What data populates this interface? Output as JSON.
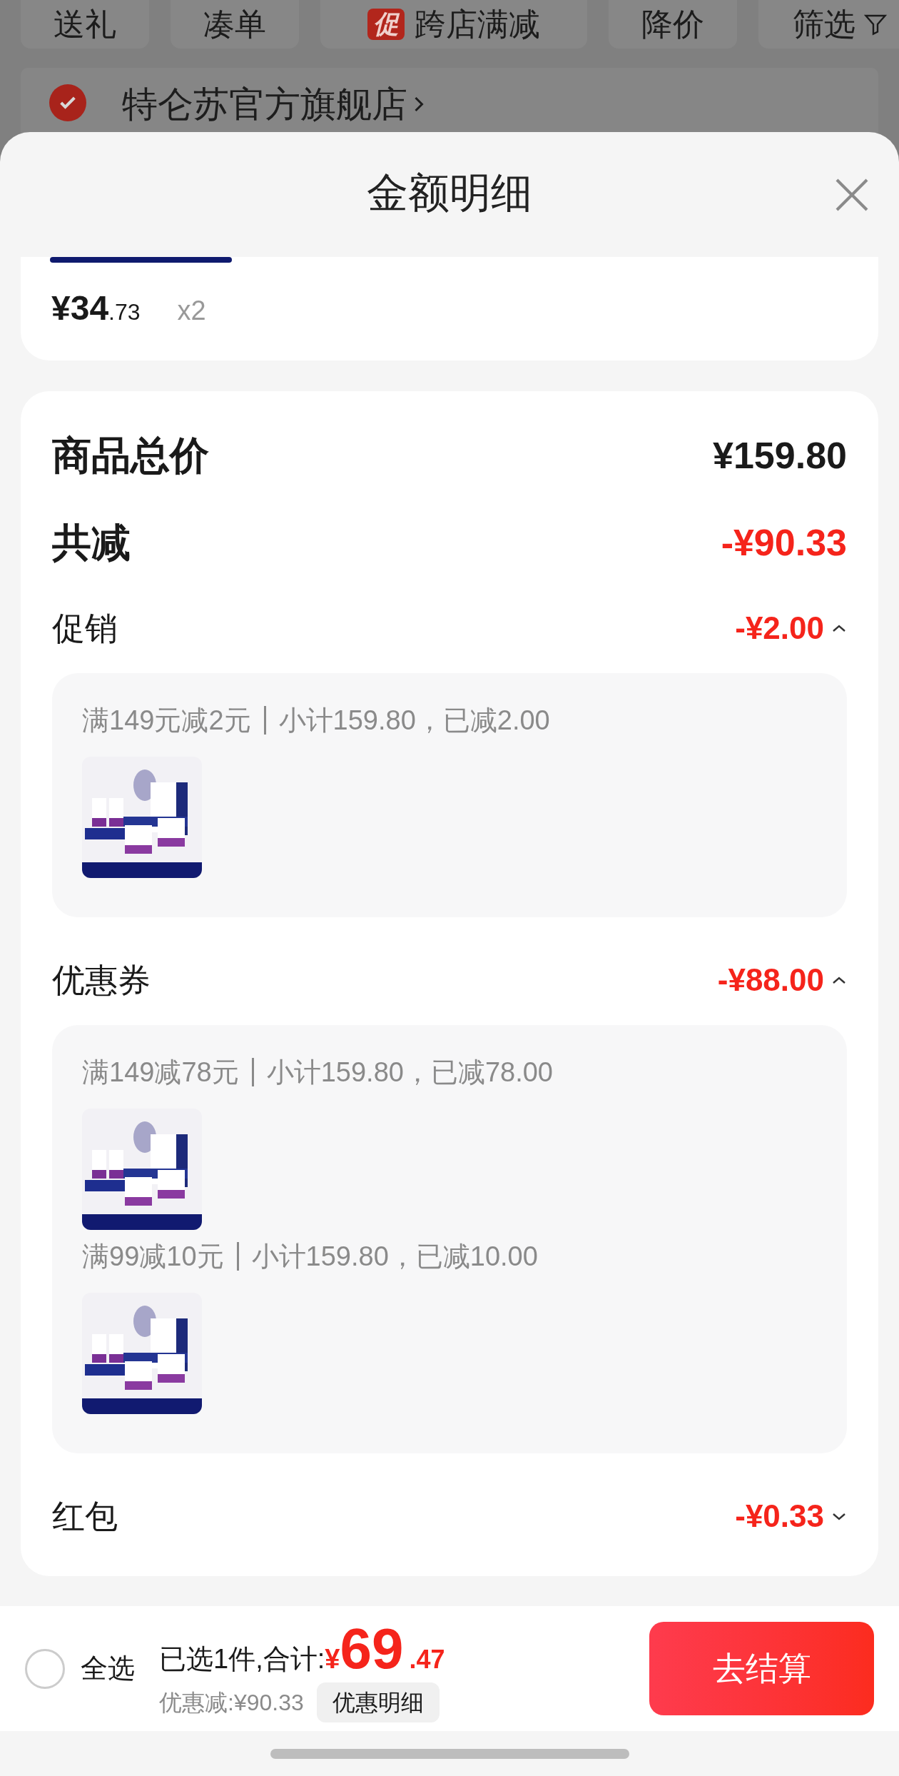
{
  "background_page": {
    "filters": [
      {
        "label": "送礼"
      },
      {
        "label": "凑单"
      },
      {
        "label": "跨店满减",
        "badge": "促"
      },
      {
        "label": "降价"
      },
      {
        "label": "筛选",
        "kind": "filter"
      }
    ],
    "store": {
      "name": "特仑苏官方旗舰店",
      "checked": true
    }
  },
  "sheet": {
    "title": "金额明细"
  },
  "item": {
    "price_main": "¥34",
    "price_decimal": ".73",
    "quantity": "x2"
  },
  "summary": {
    "total": {
      "label": "商品总价",
      "amount": "¥159.80"
    },
    "discount": {
      "label": "共减",
      "amount": "-¥90.33"
    },
    "sections": [
      {
        "label": "促销",
        "amount": "-¥2.00",
        "expanded": true,
        "groups": [
          {
            "rule": "满149元减2元",
            "detail": "小计159.80，已减2.00"
          }
        ]
      },
      {
        "label": "优惠券",
        "amount": "-¥88.00",
        "expanded": true,
        "groups": [
          {
            "rule": "满149减78元",
            "detail": "小计159.80，已减78.00"
          },
          {
            "rule": "满99减10元",
            "detail": "小计159.80，已减10.00"
          }
        ]
      },
      {
        "label": "红包",
        "amount": "-¥0.33",
        "expanded": false
      }
    ]
  },
  "bottom_bar": {
    "select_all": {
      "label": "全选",
      "checked": false
    },
    "selected_text": "已选1件,合计:",
    "currency": "¥",
    "total_main": "69",
    "total_decimal": ".47",
    "saving": "优惠减:¥90.33",
    "details_button": "优惠明细",
    "checkout_button": "去结算"
  }
}
